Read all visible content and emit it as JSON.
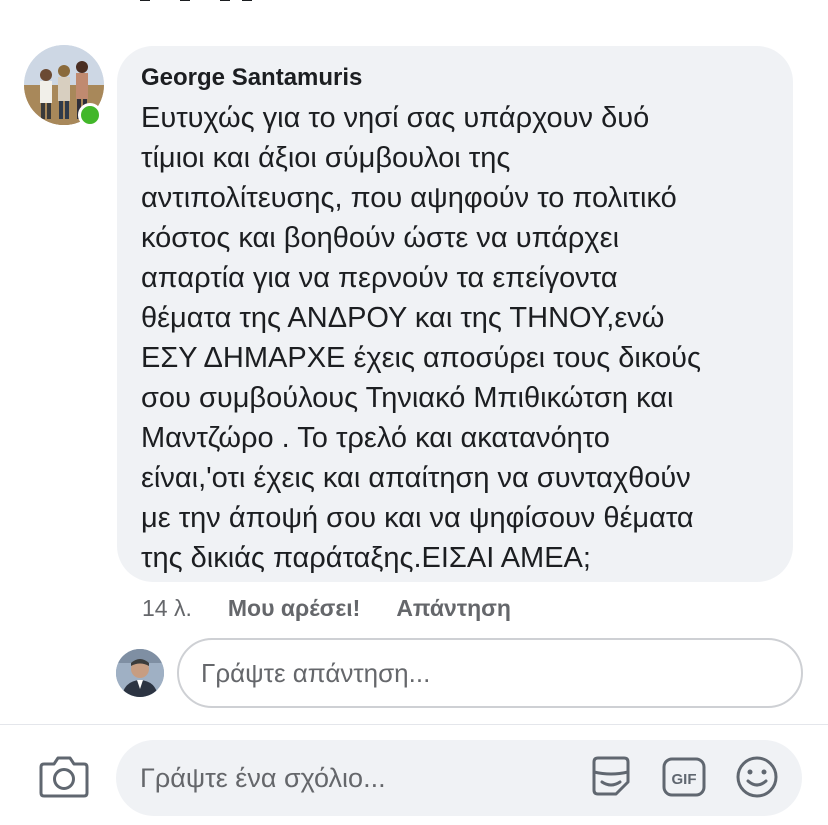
{
  "comment": {
    "author": "George Santamuris",
    "text": "Ευτυχώς για το νησί σας υπάρχουν δυό\nτίμιοι και άξιοι σύμβουλοι της\nαντιπολίτευσης, που αψηφούν το πολιτικό\nκόστος και βοηθούν ώστε να υπάρχει\nαπαρτία για να περνούν τα επείγοντα\nθέματα της ΑΝΔΡΟΥ και της ΤΗΝΟΥ,ενώ\nΕΣΥ ΔΗΜΑΡΧΕ έχεις αποσύρει τους δικούς\nσου συμβούλους Τηνιακό Μπιθικώτση και\nΜαντζώρο . Το τρελό και ακατανόητο\nείναι,'οτι έχεις και απαίτηση να συνταχθούν\nμε την άποψή σου και να ψηφίσουν θέματα\nτης δικιάς παράταξης.ΕΙΣΑΙ ΑΜΕΑ;",
    "time": "14 λ.",
    "like_label": "Μου αρέσει!",
    "reply_label": "Απάντηση",
    "author_online": true
  },
  "reply_box": {
    "placeholder": "Γράψτε απάντηση..."
  },
  "composer": {
    "placeholder": "Γράψτε ένα σχόλιο...",
    "camera_icon": "camera-icon",
    "sticker_icon": "sticker-icon",
    "gif_icon": "gif-icon",
    "gif_label": "GIF",
    "emoji_icon": "emoji-icon"
  },
  "colors": {
    "bubble_bg": "#f0f2f5",
    "online_green": "#42b72a",
    "muted_text": "#65676b",
    "icon_gray": "#606770"
  }
}
